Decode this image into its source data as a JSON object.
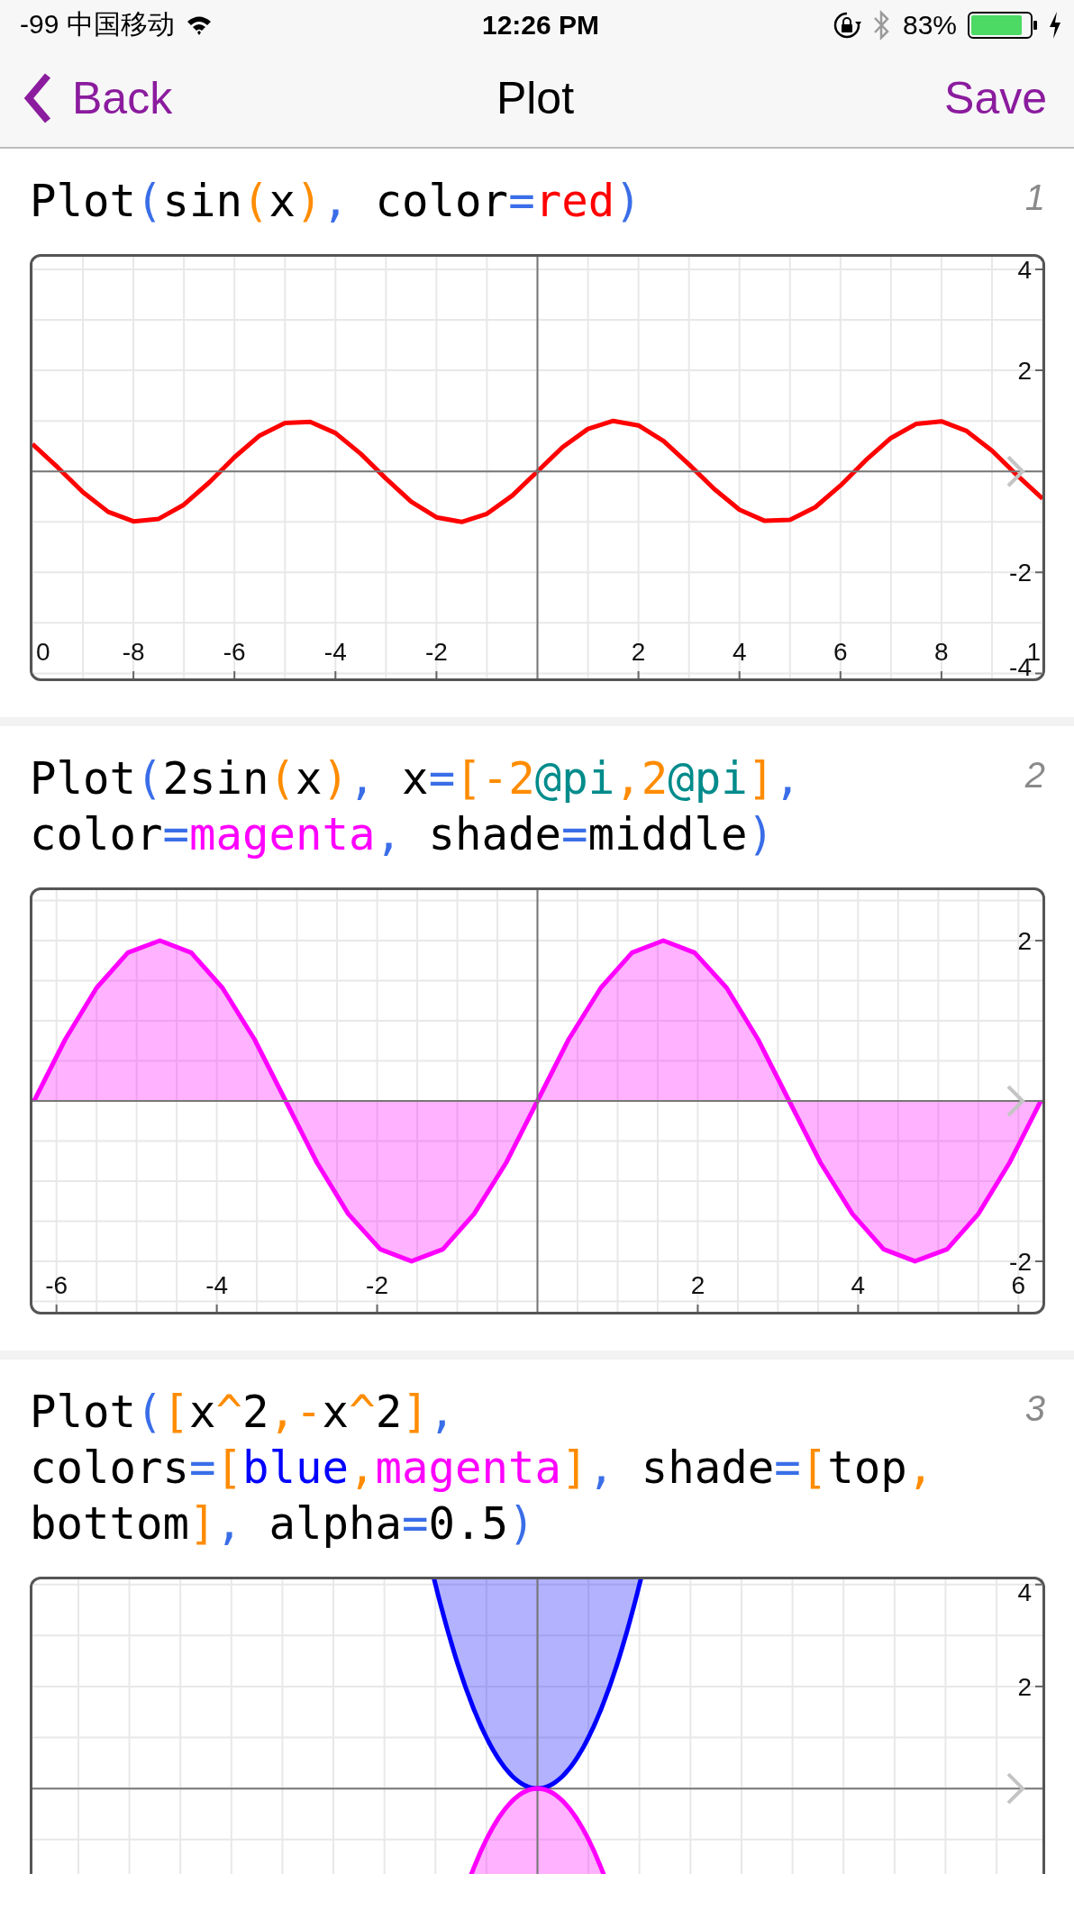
{
  "status_bar": {
    "carrier": "-99 中国移动",
    "time": "12:26 PM",
    "battery": "83%"
  },
  "nav": {
    "back": "Back",
    "title": "Plot",
    "action": "Save"
  },
  "entries": [
    {
      "number": "1",
      "code_lines": [
        [
          {
            "text": "Plot",
            "color": "#000000"
          },
          {
            "text": "(",
            "color": "#3a6ee8"
          },
          {
            "text": "sin",
            "color": "#000000"
          },
          {
            "text": "(",
            "color": "#ff8c00"
          },
          {
            "text": "x",
            "color": "#000000"
          },
          {
            "text": ")",
            "color": "#ff8c00"
          },
          {
            "text": ",",
            "color": "#3a6ee8"
          },
          {
            "text": " color",
            "color": "#000000"
          },
          {
            "text": "=",
            "color": "#3a6ee8"
          },
          {
            "text": "red",
            "color": "#ff0000"
          },
          {
            "text": ")",
            "color": "#3a6ee8"
          }
        ]
      ],
      "edge_labels": [
        "0",
        "1"
      ],
      "chart_data": {
        "type": "line",
        "grid": true,
        "xlim": [
          -10,
          10
        ],
        "ylim": [
          -4.1,
          4.25
        ],
        "xticks": [
          -8,
          -6,
          -4,
          -2,
          2,
          4,
          6,
          8
        ],
        "yticks": [
          4,
          2,
          -2,
          -4
        ],
        "x": [
          -10,
          -9.5,
          -9,
          -8.5,
          -8,
          -7.5,
          -7,
          -6.5,
          -6,
          -5.5,
          -5,
          -4.5,
          -4,
          -3.5,
          -3,
          -2.5,
          -2,
          -1.5,
          -1,
          -0.5,
          0,
          0.5,
          1,
          1.5,
          2,
          2.5,
          3,
          3.5,
          4,
          4.5,
          5,
          5.5,
          6,
          6.5,
          7,
          7.5,
          8,
          8.5,
          9,
          9.5,
          10
        ],
        "series": [
          {
            "color": "#ff0000",
            "values": [
              0.54,
              0.08,
              -0.41,
              -0.8,
              -0.99,
              -0.94,
              -0.66,
              -0.22,
              0.28,
              0.71,
              0.96,
              0.98,
              0.76,
              0.35,
              -0.14,
              -0.6,
              -0.91,
              -1,
              -0.84,
              -0.48,
              0,
              0.48,
              0.84,
              1,
              0.91,
              0.6,
              0.14,
              -0.35,
              -0.76,
              -0.98,
              -0.96,
              -0.71,
              -0.28,
              0.22,
              0.66,
              0.94,
              0.99,
              0.8,
              0.41,
              -0.08,
              -0.54
            ]
          }
        ]
      }
    },
    {
      "number": "2",
      "code_lines": [
        [
          {
            "text": "Plot",
            "color": "#000000"
          },
          {
            "text": "(",
            "color": "#3a6ee8"
          },
          {
            "text": "2sin",
            "color": "#000000"
          },
          {
            "text": "(",
            "color": "#ff8c00"
          },
          {
            "text": "x",
            "color": "#000000"
          },
          {
            "text": ")",
            "color": "#ff8c00"
          },
          {
            "text": ",",
            "color": "#3a6ee8"
          },
          {
            "text": " x",
            "color": "#000000"
          },
          {
            "text": "=",
            "color": "#3a6ee8"
          },
          {
            "text": "[-2",
            "color": "#ff8c00"
          },
          {
            "text": "@pi",
            "color": "#008b8b"
          },
          {
            "text": ",2",
            "color": "#ff8c00"
          },
          {
            "text": "@pi",
            "color": "#008b8b"
          },
          {
            "text": "]",
            "color": "#ff8c00"
          },
          {
            "text": ",",
            "color": "#3a6ee8"
          }
        ],
        [
          {
            "text": "color",
            "color": "#000000"
          },
          {
            "text": "=",
            "color": "#3a6ee8"
          },
          {
            "text": "magenta",
            "color": "#ff00ff"
          },
          {
            "text": ",",
            "color": "#3a6ee8"
          },
          {
            "text": " shade",
            "color": "#000000"
          },
          {
            "text": "=",
            "color": "#3a6ee8"
          },
          {
            "text": "middle",
            "color": "#000000"
          },
          {
            "text": ")",
            "color": "#3a6ee8"
          }
        ]
      ],
      "chart_data": {
        "type": "area",
        "grid": true,
        "xlim": [
          -6.3,
          6.3
        ],
        "ylim": [
          -2.63,
          2.63
        ],
        "xticks": [
          -6,
          -4,
          -2,
          2,
          4,
          6
        ],
        "yticks": [
          2,
          -2
        ],
        "x": [
          -6.28,
          -5.89,
          -5.5,
          -5.11,
          -4.71,
          -4.32,
          -3.93,
          -3.53,
          -3.14,
          -2.75,
          -2.36,
          -1.96,
          -1.57,
          -1.18,
          -0.79,
          -0.39,
          0,
          0.39,
          0.79,
          1.18,
          1.57,
          1.96,
          2.36,
          2.75,
          3.14,
          3.53,
          3.93,
          4.32,
          4.71,
          5.11,
          5.5,
          5.89,
          6.28
        ],
        "series": [
          {
            "color": "#ff00ff",
            "values": [
              0,
              0.77,
              1.41,
              1.85,
              2,
              1.85,
              1.41,
              0.77,
              0,
              -0.77,
              -1.41,
              -1.85,
              -2,
              -1.85,
              -1.41,
              -0.77,
              0,
              0.77,
              1.41,
              1.85,
              2,
              1.85,
              1.41,
              0.77,
              0,
              -0.77,
              -1.41,
              -1.85,
              -2,
              -1.85,
              -1.41,
              -0.77,
              0
            ]
          }
        ]
      }
    },
    {
      "number": "3",
      "code_lines": [
        [
          {
            "text": "Plot",
            "color": "#000000"
          },
          {
            "text": "(",
            "color": "#3a6ee8"
          },
          {
            "text": "[",
            "color": "#ff8c00"
          },
          {
            "text": "x",
            "color": "#000000"
          },
          {
            "text": "^",
            "color": "#ff8c00"
          },
          {
            "text": "2",
            "color": "#000000"
          },
          {
            "text": ",-",
            "color": "#ff8c00"
          },
          {
            "text": "x",
            "color": "#000000"
          },
          {
            "text": "^",
            "color": "#ff8c00"
          },
          {
            "text": "2",
            "color": "#000000"
          },
          {
            "text": "]",
            "color": "#ff8c00"
          },
          {
            "text": ",",
            "color": "#3a6ee8"
          }
        ],
        [
          {
            "text": "colors",
            "color": "#000000"
          },
          {
            "text": "=",
            "color": "#3a6ee8"
          },
          {
            "text": "[",
            "color": "#ff8c00"
          },
          {
            "text": "blue",
            "color": "#0000ff"
          },
          {
            "text": ",",
            "color": "#ff8c00"
          },
          {
            "text": "magenta",
            "color": "#ff00ff"
          },
          {
            "text": "]",
            "color": "#ff8c00"
          },
          {
            "text": ",",
            "color": "#3a6ee8"
          },
          {
            "text": " shade",
            "color": "#000000"
          },
          {
            "text": "=",
            "color": "#3a6ee8"
          },
          {
            "text": "[",
            "color": "#ff8c00"
          },
          {
            "text": "top",
            "color": "#000000"
          },
          {
            "text": ",",
            "color": "#ff8c00"
          }
        ],
        [
          {
            "text": "bottom",
            "color": "#000000"
          },
          {
            "text": "]",
            "color": "#ff8c00"
          },
          {
            "text": ",",
            "color": "#3a6ee8"
          },
          {
            "text": " alpha",
            "color": "#000000"
          },
          {
            "text": "=",
            "color": "#3a6ee8"
          },
          {
            "text": "0.5",
            "color": "#000000"
          },
          {
            "text": ")",
            "color": "#3a6ee8"
          }
        ]
      ],
      "plot_picture": {
        "y_labels": [
          "4",
          "2"
        ]
      }
    }
  ]
}
